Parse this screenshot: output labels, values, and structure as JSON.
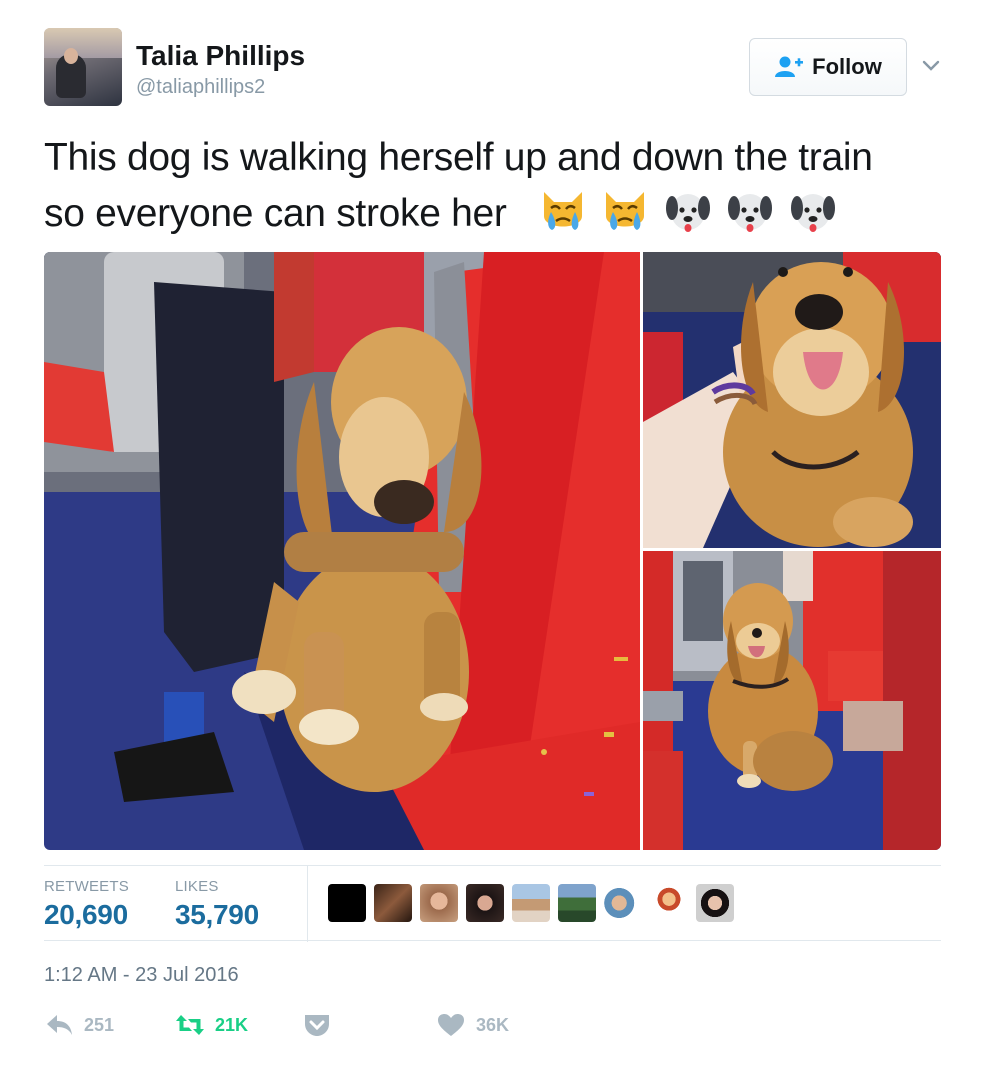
{
  "header": {
    "display_name": "Talia Phillips",
    "handle": "@taliaphillips2",
    "follow_label": "Follow"
  },
  "tweet": {
    "text_line1": "This dog is walking herself up and down the train",
    "text_line2": "so everyone can stroke her",
    "emojis": [
      "crying-cat-face",
      "crying-cat-face",
      "dog-face",
      "dog-face",
      "dog-face"
    ]
  },
  "media": {
    "photos": [
      "dog-walking-in-train-aisle",
      "golden-retriever-smiling-being-petted",
      "golden-retriever-sitting-between-seats"
    ]
  },
  "stats": {
    "retweets_label": "RETWEETS",
    "retweets_value": "20,690",
    "likes_label": "LIKES",
    "likes_value": "35,790",
    "liker_avatars": 9
  },
  "timestamp": "1:12 AM - 23 Jul 2016",
  "actions": {
    "reply_count": "251",
    "retweet_count": "21K",
    "like_count": "36K"
  },
  "colors": {
    "accent_blue": "#1b6c9e",
    "retweet_green": "#19cf86",
    "muted_gray": "#aab8c2",
    "seat_red": "#e5312e",
    "carpet_blue": "#2f3a8a"
  }
}
